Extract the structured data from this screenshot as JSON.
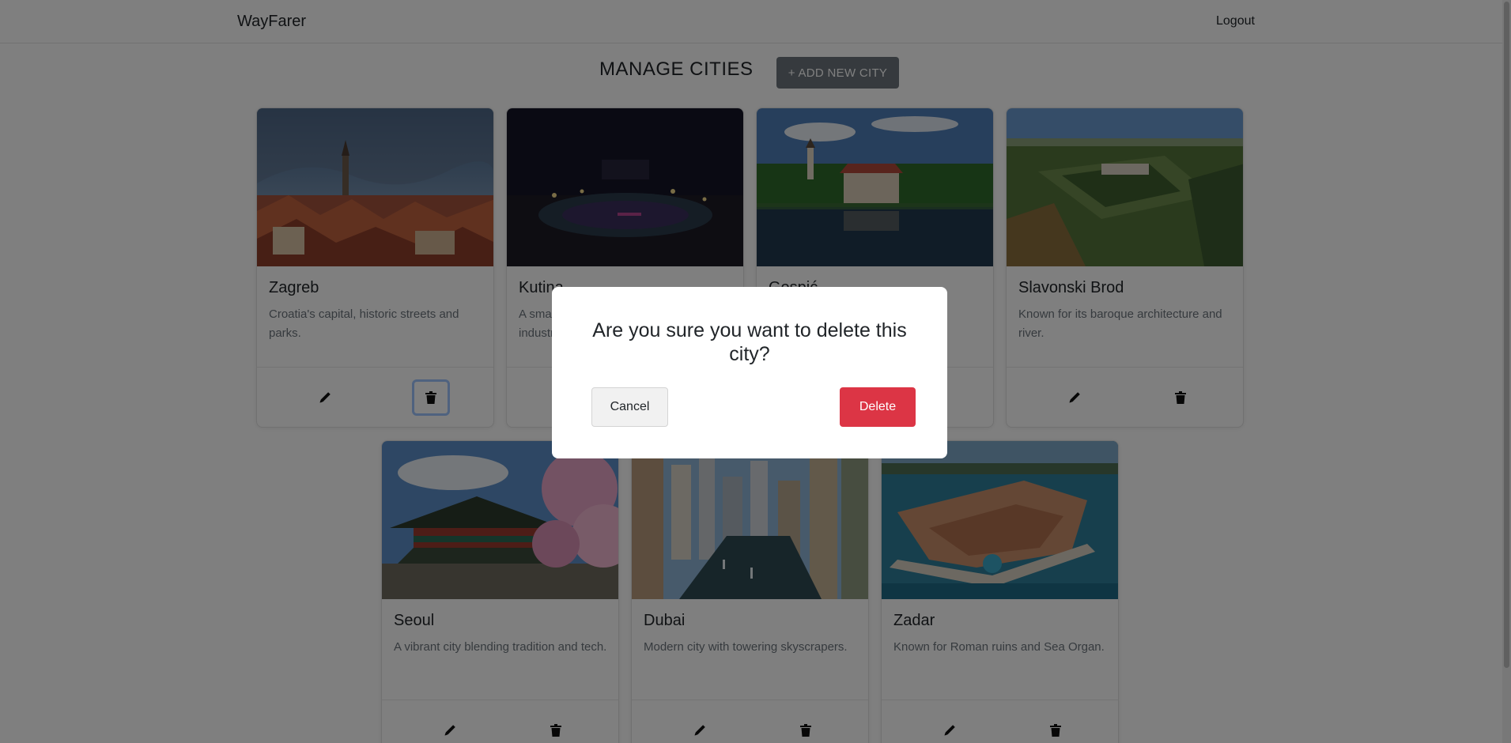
{
  "navbar": {
    "brand": "WayFarer",
    "logout": "Logout"
  },
  "header": {
    "title": "MANAGE CITIES",
    "add_button": "+ ADD NEW CITY"
  },
  "cities": [
    {
      "name": "Zagreb",
      "description": "Croatia's capital, historic streets and parks."
    },
    {
      "name": "Kutina",
      "description": "A small town with green parks and industrial heritage."
    },
    {
      "name": "Gospić",
      "description": ""
    },
    {
      "name": "Slavonski Brod",
      "description": "Known for its baroque architecture and river."
    },
    {
      "name": "Seoul",
      "description": "A vibrant city blending tradition and tech."
    },
    {
      "name": "Dubai",
      "description": "Modern city with towering skyscrapers."
    },
    {
      "name": "Zadar",
      "description": "Known for Roman ruins and Sea Organ."
    }
  ],
  "modal": {
    "message": "Are you sure you want to delete this city?",
    "cancel_label": "Cancel",
    "delete_label": "Delete"
  },
  "icons": {
    "edit": "pencil-icon",
    "delete": "trash-icon"
  },
  "colors": {
    "danger": "#dc3545",
    "secondary": "#6c757d",
    "focus_ring": "#9ec5fe"
  }
}
